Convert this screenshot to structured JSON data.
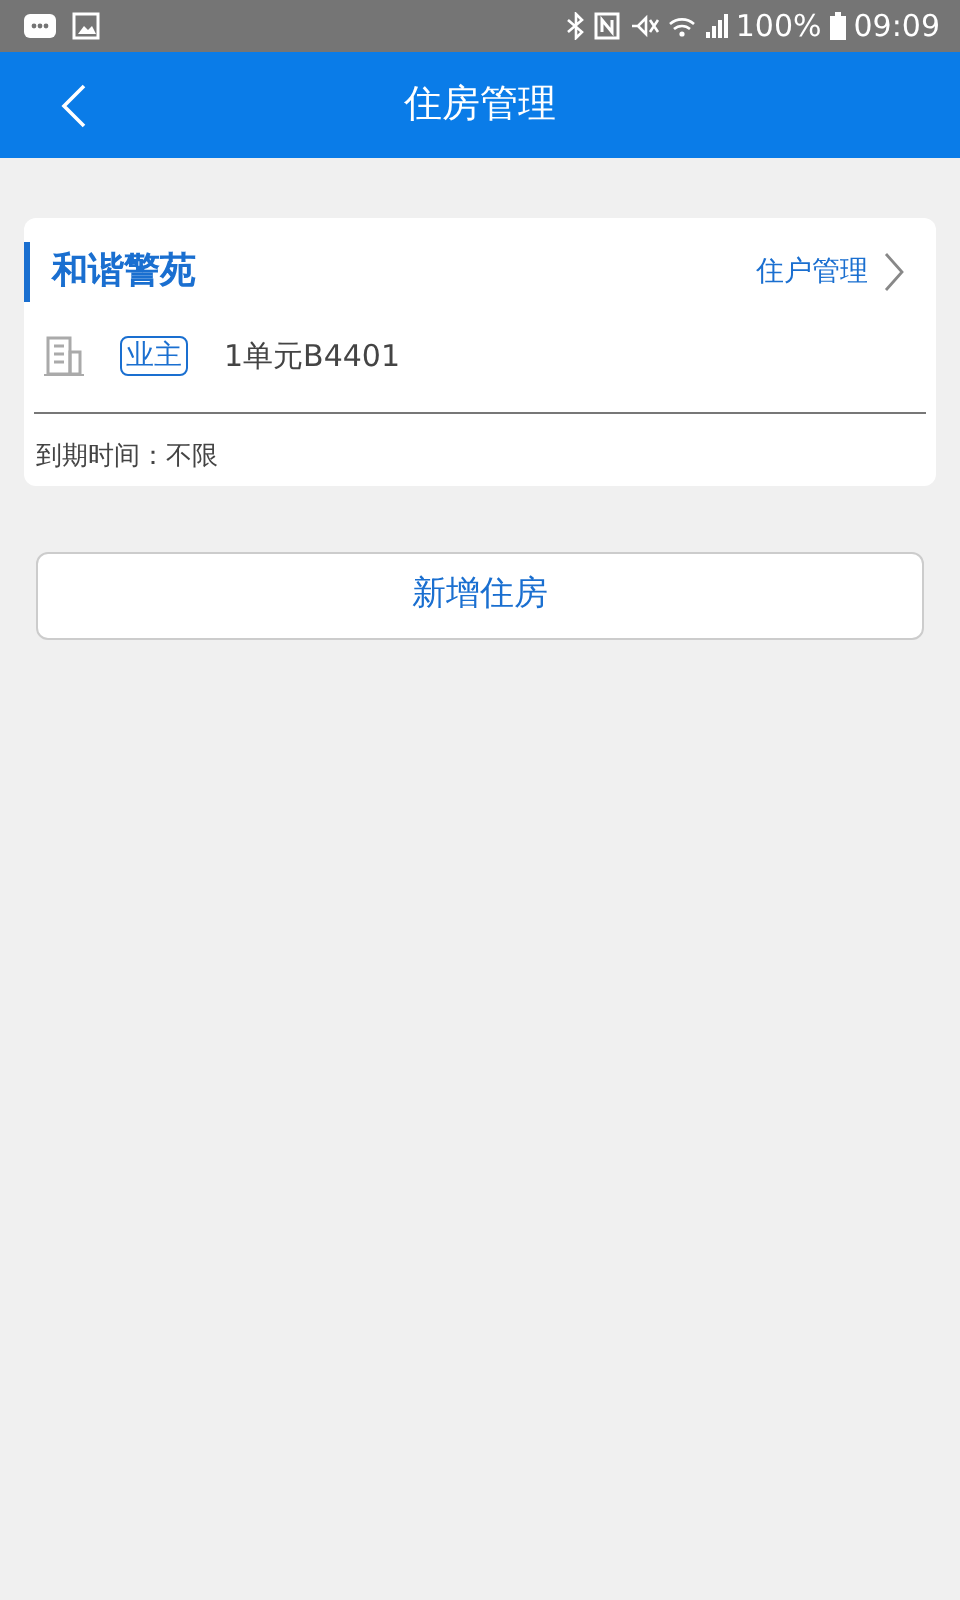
{
  "status_bar": {
    "battery": "100%",
    "time": "09:09"
  },
  "app_bar": {
    "title": "住房管理"
  },
  "houses": [
    {
      "name": "和谐警苑",
      "manage_link": "住户管理",
      "role_badge": "业主",
      "unit": "1单元B4401",
      "expiry": "到期时间：不限"
    }
  ],
  "add_button": "新增住房"
}
